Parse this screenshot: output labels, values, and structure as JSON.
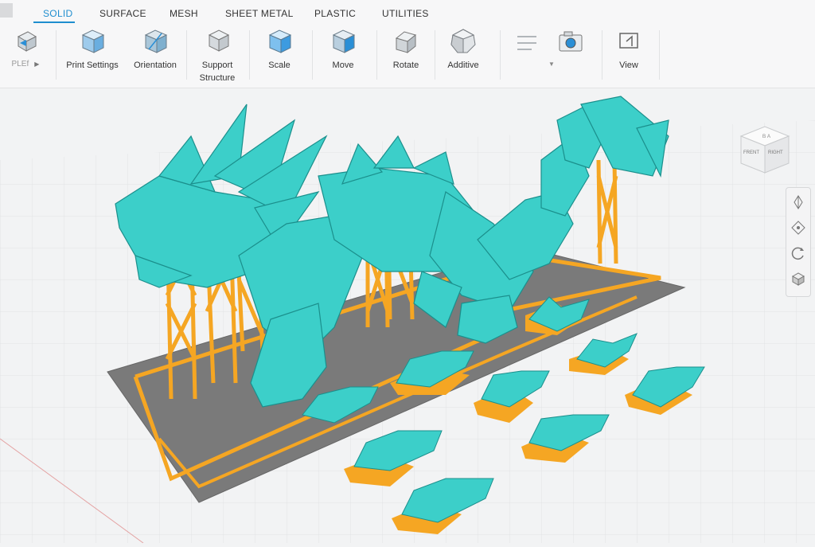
{
  "tabs": [
    {
      "label": "SOLID",
      "active": true
    },
    {
      "label": "SURFACE",
      "active": false
    },
    {
      "label": "MESH",
      "active": false
    },
    {
      "label": "SHEET METAL",
      "active": false
    },
    {
      "label": "PLASTIC",
      "active": false
    },
    {
      "label": "UTILITIES",
      "active": false
    }
  ],
  "toolbar": {
    "first_label": "PLEf",
    "print_settings": "Print Settings",
    "orientation": "Orientation",
    "support_structure_1": "Support",
    "support_structure_2": "Structure",
    "scale": "Scale",
    "move": "Move",
    "rotate": "Rotate",
    "additive": "Additive",
    "view": "View"
  },
  "viewcube": {
    "top": "ＢＡ",
    "front": "FRENT",
    "right": "RIGHT"
  },
  "colors": {
    "accent": "#1f8ecf",
    "model": "#3ccfc9",
    "support": "#f5a623",
    "plate": "#7a7a7a"
  }
}
